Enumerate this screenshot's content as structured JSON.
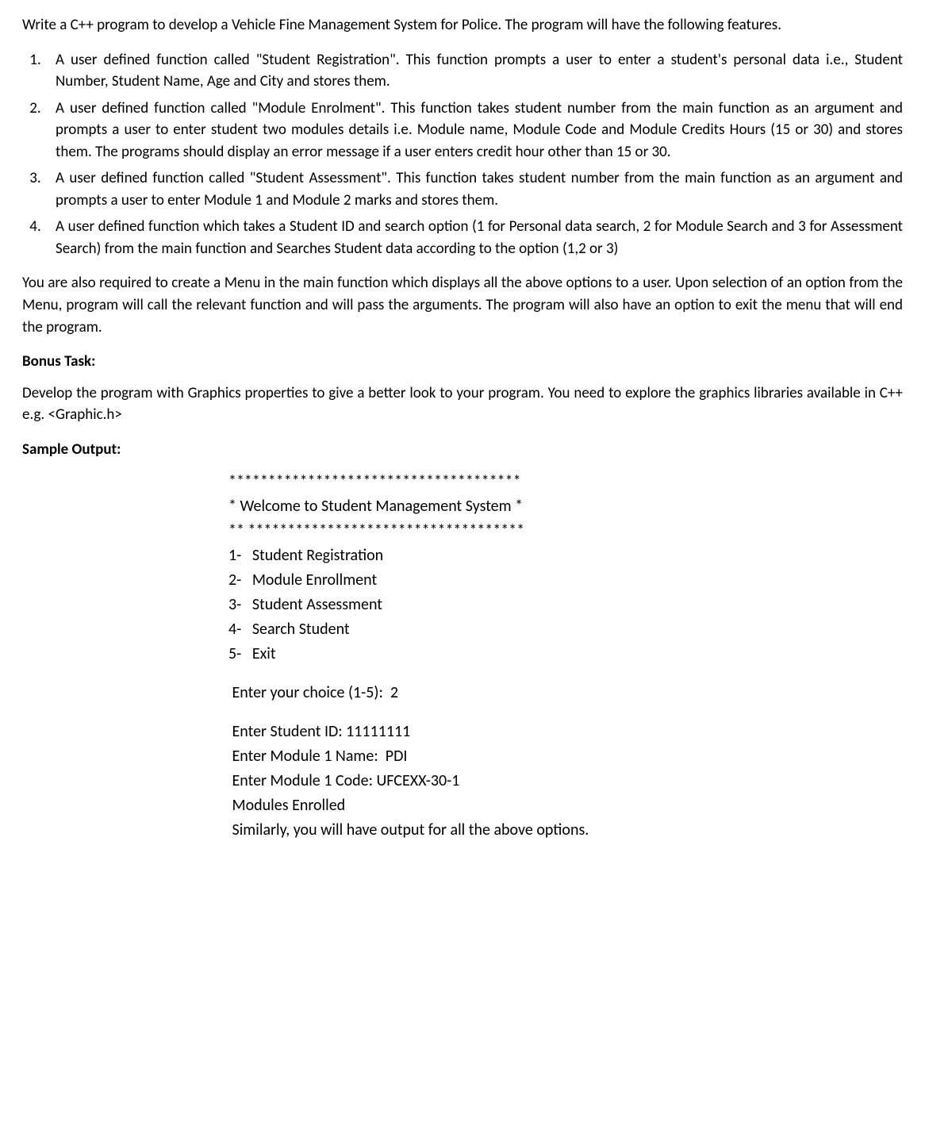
{
  "intro": "Write a C++ program to develop a Vehicle Fine Management System for Police. The program will have the following features.",
  "list": [
    "A user defined function called \"Student Registration\". This function prompts a user to enter a student's personal data i.e., Student Number, Student Name, Age and City and stores them.",
    "A user defined function called \"Module Enrolment\". This function takes student number from the main function as an argument and prompts a user to enter student two modules details i.e. Module name, Module Code and Module Credits Hours (15 or 30) and stores them. The programs should display an error message if a user enters credit hour other than 15 or 30.",
    "A user defined function called \"Student Assessment\". This function takes student number from the main function as an argument and prompts a user to enter Module 1 and Module 2 marks and stores them.",
    "A user defined function which takes a Student ID and search option (1 for Personal data search, 2 for Module Search and 3 for Assessment Search) from the main function and Searches Student data according to the option (1,2 or 3)"
  ],
  "menu_para": "You are also required to create a Menu in the main function which displays all the above options to a user. Upon selection of an option from the Menu, program will call the relevant function and will pass the arguments. The program will also have an option to exit the menu that will end the program.",
  "bonus_head": "Bonus Task:",
  "bonus_body": "Develop the program with Graphics properties to give a better look to your program. You need to explore the graphics libraries available in C++ e.g. <Graphic.h>",
  "sample_head": "Sample Output:",
  "sample": {
    "stars_top": "*************************************",
    "welcome": "* Welcome to Student Management System *",
    "stars_bot": "** ***********************************",
    "menu": [
      "1-   Student Registration",
      "2-   Module Enrollment",
      "3-   Student Assessment",
      "4-   Search Student",
      "5-   Exit"
    ],
    "prompt": " Enter your choice (1-5):  2",
    "out": [
      " Enter Student ID: 11111111",
      " Enter Module 1 Name:  PDI",
      " Enter Module 1 Code: UFCEXX-30-1",
      " Modules Enrolled",
      " Similarly, you will have output for all the above options."
    ]
  }
}
